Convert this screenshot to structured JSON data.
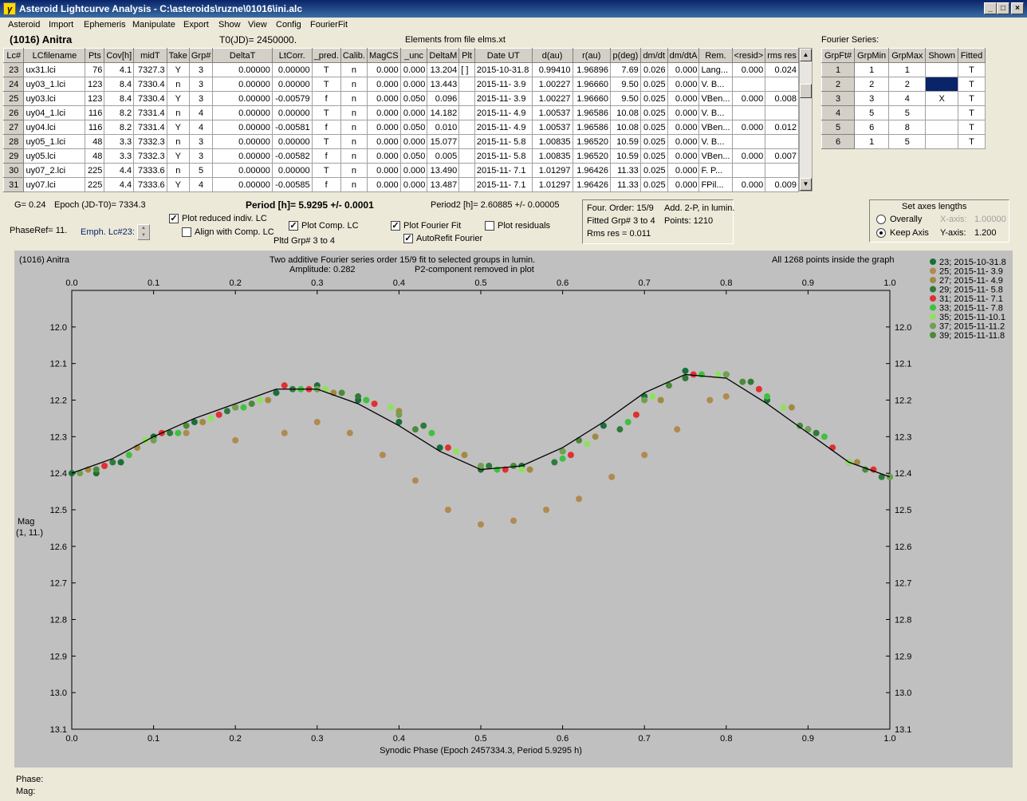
{
  "window": {
    "title": "Asteroid Lightcurve Analysis - C:\\asteroids\\ruzne\\01016\\ini.alc",
    "icon_name": "app-icon",
    "buttons": [
      "_",
      "□",
      "×"
    ]
  },
  "menu": [
    "Asteroid",
    "Import",
    "Ephemeris",
    "Manipulate",
    "Export",
    "Show",
    "View",
    "Config",
    "FourierFit"
  ],
  "header": {
    "asteroid": "(1016) Anitra",
    "t0": "T0(JD)= 2450000.",
    "elements": "Elements from file elms.xt",
    "fourier_label": "Fourier Series:"
  },
  "lc_table": {
    "columns": [
      "Lc#",
      "LCfilename",
      "Pts",
      "Cov[h]",
      "midT",
      "Take",
      "Grp#",
      "DeltaT",
      "LtCorr.",
      "_pred.",
      "Calib.",
      "MagCS",
      "_unc",
      "DeltaM",
      "Plt",
      "Date UT",
      "d(au)",
      "r(au)",
      "p(deg)",
      "dm/dt",
      "dm/dtA",
      "Rem.",
      "<resid>",
      "rms res"
    ],
    "rows": [
      [
        "23",
        "ux31.lci",
        "76",
        "4.1",
        "7327.3",
        "Y",
        "3",
        "0.00000",
        "0.00000",
        "T",
        "n",
        "0.000",
        "0.000",
        "13.204",
        "[ ]",
        "2015-10-31.8",
        "0.99410",
        "1.96896",
        "7.69",
        "0.026",
        "0.000",
        "Lang...",
        "0.000",
        "0.024"
      ],
      [
        "24",
        "uy03_1.lci",
        "123",
        "8.4",
        "7330.4",
        "n",
        "3",
        "0.00000",
        "0.00000",
        "T",
        "n",
        "0.000",
        "0.000",
        "13.443",
        "",
        "2015-11- 3.9",
        "1.00227",
        "1.96660",
        "9.50",
        "0.025",
        "0.000",
        "V. B...",
        "",
        ""
      ],
      [
        "25",
        "uy03.lci",
        "123",
        "8.4",
        "7330.4",
        "Y",
        "3",
        "0.00000",
        "-0.00579",
        "f",
        "n",
        "0.000",
        "0.050",
        "0.096",
        "",
        "2015-11- 3.9",
        "1.00227",
        "1.96660",
        "9.50",
        "0.025",
        "0.000",
        "VBen...",
        "0.000",
        "0.008"
      ],
      [
        "26",
        "uy04_1.lci",
        "116",
        "8.2",
        "7331.4",
        "n",
        "4",
        "0.00000",
        "0.00000",
        "T",
        "n",
        "0.000",
        "0.000",
        "14.182",
        "",
        "2015-11- 4.9",
        "1.00537",
        "1.96586",
        "10.08",
        "0.025",
        "0.000",
        "V. B...",
        "",
        ""
      ],
      [
        "27",
        "uy04.lci",
        "116",
        "8.2",
        "7331.4",
        "Y",
        "4",
        "0.00000",
        "-0.00581",
        "f",
        "n",
        "0.000",
        "0.050",
        "0.010",
        "",
        "2015-11- 4.9",
        "1.00537",
        "1.96586",
        "10.08",
        "0.025",
        "0.000",
        "VBen...",
        "0.000",
        "0.012"
      ],
      [
        "28",
        "uy05_1.lci",
        "48",
        "3.3",
        "7332.3",
        "n",
        "3",
        "0.00000",
        "0.00000",
        "T",
        "n",
        "0.000",
        "0.000",
        "15.077",
        "",
        "2015-11- 5.8",
        "1.00835",
        "1.96520",
        "10.59",
        "0.025",
        "0.000",
        "V. B...",
        "",
        ""
      ],
      [
        "29",
        "uy05.lci",
        "48",
        "3.3",
        "7332.3",
        "Y",
        "3",
        "0.00000",
        "-0.00582",
        "f",
        "n",
        "0.000",
        "0.050",
        "0.005",
        "",
        "2015-11- 5.8",
        "1.00835",
        "1.96520",
        "10.59",
        "0.025",
        "0.000",
        "VBen...",
        "0.000",
        "0.007"
      ],
      [
        "30",
        "uy07_2.lci",
        "225",
        "4.4",
        "7333.6",
        "n",
        "5",
        "0.00000",
        "0.00000",
        "T",
        "n",
        "0.000",
        "0.000",
        "13.490",
        "",
        "2015-11- 7.1",
        "1.01297",
        "1.96426",
        "11.33",
        "0.025",
        "0.000",
        "F. P...",
        "",
        ""
      ],
      [
        "31",
        "uy07.lci",
        "225",
        "4.4",
        "7333.6",
        "Y",
        "4",
        "0.00000",
        "-0.00585",
        "f",
        "n",
        "0.000",
        "0.000",
        "13.487",
        "",
        "2015-11- 7.1",
        "1.01297",
        "1.96426",
        "11.33",
        "0.025",
        "0.000",
        "FPil...",
        "0.000",
        "0.009"
      ]
    ]
  },
  "fourier_table": {
    "columns": [
      "GrpFt#",
      "GrpMin",
      "GrpMax",
      "Shown",
      "Fitted"
    ],
    "rows": [
      [
        "1",
        "1",
        "1",
        "",
        "T"
      ],
      [
        "2",
        "2",
        "2",
        "",
        "T"
      ],
      [
        "3",
        "3",
        "4",
        "X",
        "T"
      ],
      [
        "4",
        "5",
        "5",
        "",
        "T"
      ],
      [
        "5",
        "6",
        "8",
        "",
        "T"
      ],
      [
        "6",
        "1",
        "5",
        "",
        "T"
      ]
    ]
  },
  "controls": {
    "g": "G= 0.24",
    "epoch": "Epoch (JD-T0)= 7334.3",
    "period": "Period [h]= 5.9295 +/- 0.0001",
    "period2": "Period2 [h]= 2.60885 +/- 0.00005",
    "phase_ref": "PhaseRef= 11.",
    "emph": "Emph. Lc#23:",
    "plot_reduced": "Plot reduced indiv. LC",
    "align": "Align with Comp. LC",
    "plot_comp": "Plot Comp. LC",
    "pltd_grp": "Pltd Grp#  3  to   4",
    "plot_fourier": "Plot Fourier Fit",
    "autorefit": "AutoRefit Fourier",
    "plot_residuals": "Plot residuals",
    "four_order": "Four. Order: 15/9",
    "add2p": "Add. 2-P, in lumin.",
    "fitted_grp": "Fitted Grp# 3 to 4",
    "points": "Points: 1210",
    "rms": "Rms res     = 0.011",
    "axes_title": "Set axes lengths",
    "overally": "Overally",
    "keep_axis": "Keep Axis",
    "xaxis_label": "X-axis:",
    "xaxis_val": "1.00000",
    "yaxis_label": "Y-axis:",
    "yaxis_val": "1.200"
  },
  "plot_text": {
    "name": "(1016) Anitra",
    "fit_desc": "Two additive Fourier series order 15/9 fit to selected groups in lumin.",
    "amplitude": "Amplitude: 0.282",
    "p2": "P2-component removed in plot",
    "inside": "All 1268 points inside the graph",
    "ylabel1": "Mag",
    "ylabel2": "(1, 11.)"
  },
  "chart_data": {
    "type": "scatter",
    "xlabel": "Synodic Phase (Epoch 2457334.3, Period 5.9295 h)",
    "ylabel": "Mag",
    "xlim": [
      0.0,
      1.0
    ],
    "ylim": [
      13.1,
      11.9
    ],
    "x_ticks": [
      "0.0",
      "0.1",
      "0.2",
      "0.3",
      "0.4",
      "0.5",
      "0.6",
      "0.7",
      "0.8",
      "0.9",
      "1.0"
    ],
    "y_ticks": [
      "12.0",
      "12.1",
      "12.2",
      "12.3",
      "12.4",
      "12.5",
      "12.6",
      "12.7",
      "12.8",
      "12.9",
      "13.0",
      "13.1"
    ],
    "legend_position": "right",
    "series": [
      {
        "name": "23; 2015-10-31.8",
        "color": "#1a6e3a",
        "x": [
          0.0,
          0.03,
          0.06,
          0.1,
          0.15,
          0.2,
          0.25,
          0.3,
          0.35,
          0.4,
          0.45,
          0.5,
          0.55,
          0.6,
          0.65,
          0.7,
          0.75,
          0.8,
          0.85,
          0.9,
          0.95,
          1.0
        ],
        "y": [
          12.4,
          12.4,
          12.37,
          12.3,
          12.26,
          12.22,
          12.18,
          12.16,
          12.2,
          12.26,
          12.33,
          12.39,
          12.38,
          12.34,
          12.27,
          12.19,
          12.12,
          12.13,
          12.2,
          12.28,
          12.37,
          12.41
        ]
      },
      {
        "name": "25; 2015-11- 3.9",
        "color": "#b08a50",
        "x": [
          0.14,
          0.2,
          0.26,
          0.3,
          0.34,
          0.38,
          0.42,
          0.46,
          0.5,
          0.54,
          0.58,
          0.62,
          0.66,
          0.7,
          0.74,
          0.78,
          0.8
        ],
        "y": [
          12.29,
          12.31,
          12.29,
          12.26,
          12.29,
          12.35,
          12.42,
          12.5,
          12.54,
          12.53,
          12.5,
          12.47,
          12.41,
          12.35,
          12.28,
          12.2,
          12.19
        ]
      },
      {
        "name": "27; 2015-11- 4.9",
        "color": "#a08a40",
        "x": [
          0.02,
          0.08,
          0.16,
          0.24,
          0.32,
          0.4,
          0.48,
          0.56,
          0.64,
          0.72,
          0.8,
          0.88,
          0.96
        ],
        "y": [
          12.39,
          12.33,
          12.26,
          12.2,
          12.18,
          12.23,
          12.35,
          12.39,
          12.3,
          12.2,
          12.13,
          12.22,
          12.37
        ]
      },
      {
        "name": "29; 2015-11- 5.8",
        "color": "#2f7a3a",
        "x": [
          0.05,
          0.12,
          0.19,
          0.27,
          0.35,
          0.43,
          0.51,
          0.59,
          0.67,
          0.75,
          0.83,
          0.91,
          0.99
        ],
        "y": [
          12.37,
          12.29,
          12.23,
          12.17,
          12.19,
          12.27,
          12.38,
          12.37,
          12.28,
          12.14,
          12.15,
          12.29,
          12.41
        ]
      },
      {
        "name": "31; 2015-11- 7.1",
        "color": "#e03030",
        "x": [
          0.04,
          0.11,
          0.18,
          0.26,
          0.29,
          0.37,
          0.46,
          0.53,
          0.61,
          0.69,
          0.76,
          0.84,
          0.93,
          0.98
        ],
        "y": [
          12.38,
          12.29,
          12.24,
          12.16,
          12.17,
          12.21,
          12.33,
          12.39,
          12.35,
          12.24,
          12.13,
          12.17,
          12.33,
          12.39
        ]
      },
      {
        "name": "33; 2015-11- 7.8",
        "color": "#40c040",
        "x": [
          0.07,
          0.13,
          0.21,
          0.28,
          0.36,
          0.44,
          0.52,
          0.6,
          0.68,
          0.77,
          0.85,
          0.92
        ],
        "y": [
          12.35,
          12.29,
          12.22,
          12.17,
          12.2,
          12.29,
          12.39,
          12.36,
          12.26,
          12.13,
          12.19,
          12.3
        ]
      },
      {
        "name": "35; 2015-11-10.1",
        "color": "#90e060",
        "x": [
          0.09,
          0.17,
          0.23,
          0.31,
          0.39,
          0.47,
          0.55,
          0.63,
          0.71,
          0.79,
          0.87,
          0.95
        ],
        "y": [
          12.31,
          12.25,
          12.2,
          12.17,
          12.22,
          12.34,
          12.39,
          12.32,
          12.19,
          12.13,
          12.22,
          12.37
        ]
      },
      {
        "name": "37; 2015-11-11.2",
        "color": "#70a050",
        "x": [
          0.01,
          0.1,
          0.2,
          0.3,
          0.4,
          0.5,
          0.6,
          0.7,
          0.8,
          0.9,
          1.0
        ],
        "y": [
          12.4,
          12.31,
          12.22,
          12.17,
          12.24,
          12.38,
          12.34,
          12.2,
          12.13,
          12.28,
          12.41
        ]
      },
      {
        "name": "39; 2015-11-11.8",
        "color": "#4a8a3a",
        "x": [
          0.03,
          0.14,
          0.22,
          0.33,
          0.42,
          0.54,
          0.62,
          0.73,
          0.82,
          0.89,
          0.97
        ],
        "y": [
          12.39,
          12.27,
          12.21,
          12.18,
          12.28,
          12.38,
          12.31,
          12.16,
          12.15,
          12.27,
          12.39
        ]
      }
    ],
    "fit_line": {
      "x": [
        0.0,
        0.05,
        0.1,
        0.15,
        0.2,
        0.25,
        0.3,
        0.35,
        0.4,
        0.45,
        0.5,
        0.55,
        0.6,
        0.65,
        0.7,
        0.75,
        0.8,
        0.85,
        0.9,
        0.95,
        1.0
      ],
      "y": [
        12.4,
        12.36,
        12.3,
        12.25,
        12.21,
        12.17,
        12.17,
        12.21,
        12.27,
        12.34,
        12.39,
        12.38,
        12.33,
        12.26,
        12.18,
        12.13,
        12.14,
        12.21,
        12.29,
        12.37,
        12.41
      ]
    }
  },
  "status": {
    "phase": "Phase:",
    "mag": "Mag:"
  },
  "colors": {
    "selected_cell": "#0a246a",
    "plot_bg": "#c0c0c0",
    "fit_line": "#000000"
  }
}
